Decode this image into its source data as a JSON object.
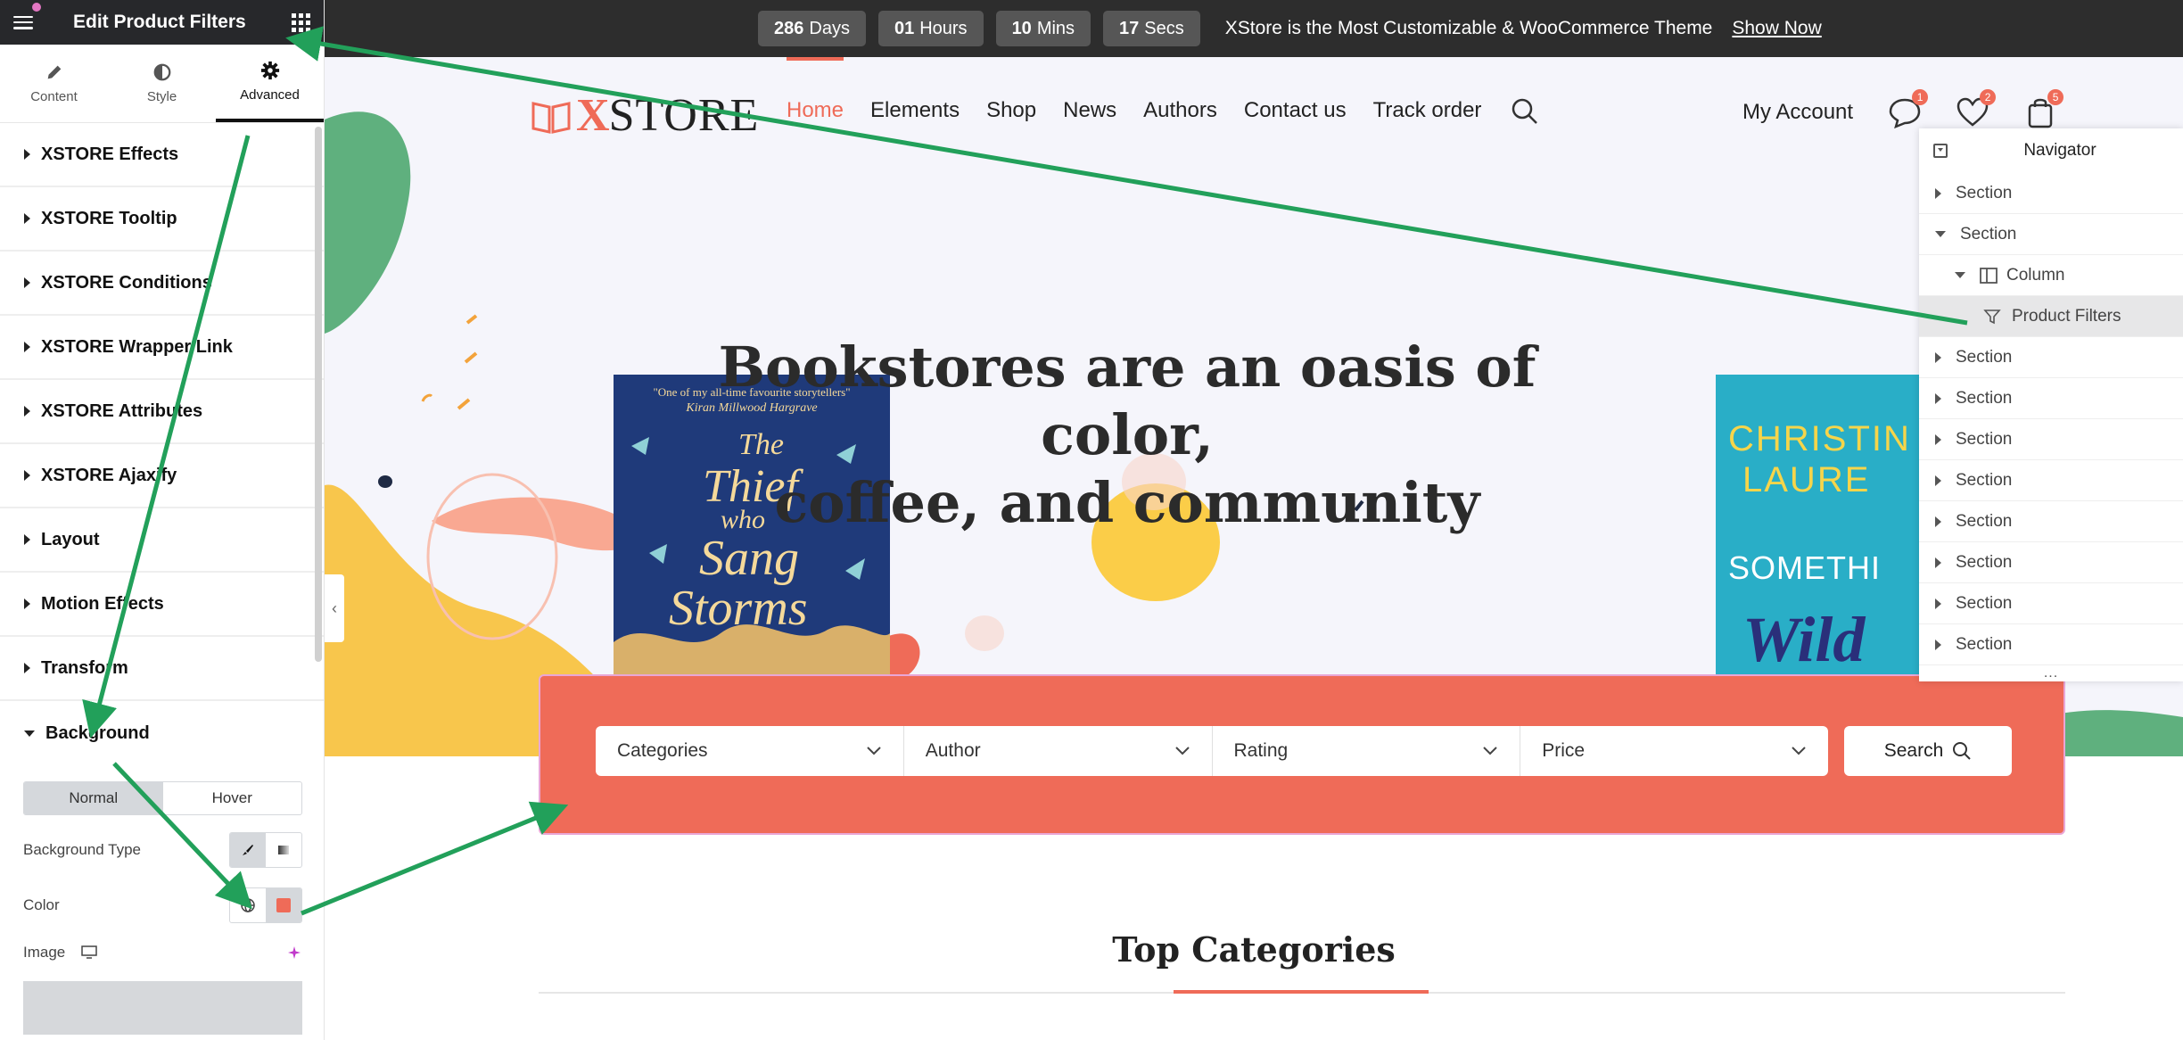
{
  "panel": {
    "title": "Edit Product Filters",
    "tabs": [
      {
        "label": "Content",
        "icon": "pencil-icon"
      },
      {
        "label": "Style",
        "icon": "half-circle-icon"
      },
      {
        "label": "Advanced",
        "icon": "gear-icon",
        "active": true
      }
    ],
    "sections": [
      "XSTORE Effects",
      "XSTORE Tooltip",
      "XSTORE Conditions",
      "XSTORE Wrapper Link",
      "XSTORE Attributes",
      "XSTORE Ajaxify",
      "Layout",
      "Motion Effects",
      "Transform",
      "Background"
    ],
    "background": {
      "state_tabs": [
        "Normal",
        "Hover"
      ],
      "type_label": "Background Type",
      "color_label": "Color",
      "color_value": "#ef6b58",
      "image_label": "Image"
    }
  },
  "topbar": {
    "countdown": [
      {
        "num": "286",
        "unit": "Days"
      },
      {
        "num": "01",
        "unit": "Hours"
      },
      {
        "num": "10",
        "unit": "Mins"
      },
      {
        "num": "17",
        "unit": "Secs"
      }
    ],
    "promo": "XStore is the Most Customizable & WooCommerce Theme",
    "cta": "Show Now"
  },
  "site": {
    "logo_x": "X",
    "logo_rest": "STORE",
    "menu": [
      "Home",
      "Elements",
      "Shop",
      "News",
      "Authors",
      "Contact us",
      "Track order"
    ],
    "account": "My Account",
    "badges": {
      "messages": "1",
      "wishlist": "2",
      "cart": "5"
    },
    "headline_1": "Bookstores are an oasis of color,",
    "headline_2": "coffee, and community",
    "filters": [
      "Categories",
      "Author",
      "Rating",
      "Price"
    ],
    "search_label": "Search",
    "top_categories": "Top Categories",
    "book_left": {
      "quote": "\"One of my all-time favourite storytellers\"",
      "author": "Kiran Millwood Hargrave",
      "title_1": "The",
      "title_2": "Thief",
      "title_3": "who",
      "title_4": "Sang",
      "title_5": "Storms"
    },
    "book_right": {
      "line1": "CHRISTIN",
      "line2": "LAURE",
      "line3": "SOMETHI",
      "line4": "Wild"
    }
  },
  "navigator": {
    "title": "Navigator",
    "rows": [
      {
        "label": "Section",
        "kind": "section"
      },
      {
        "label": "Section",
        "kind": "section-open"
      },
      {
        "label": "Column",
        "kind": "column"
      },
      {
        "label": "Product Filters",
        "kind": "widget"
      },
      {
        "label": "Section",
        "kind": "section"
      },
      {
        "label": "Section",
        "kind": "section"
      },
      {
        "label": "Section",
        "kind": "section"
      },
      {
        "label": "Section",
        "kind": "section"
      },
      {
        "label": "Section",
        "kind": "section"
      },
      {
        "label": "Section",
        "kind": "section"
      },
      {
        "label": "Section",
        "kind": "section"
      },
      {
        "label": "Section",
        "kind": "section"
      }
    ],
    "more": "..."
  },
  "colors": {
    "accent": "#ef6b58",
    "annotation_arrow": "#22a05a",
    "dark": "#27282b"
  }
}
